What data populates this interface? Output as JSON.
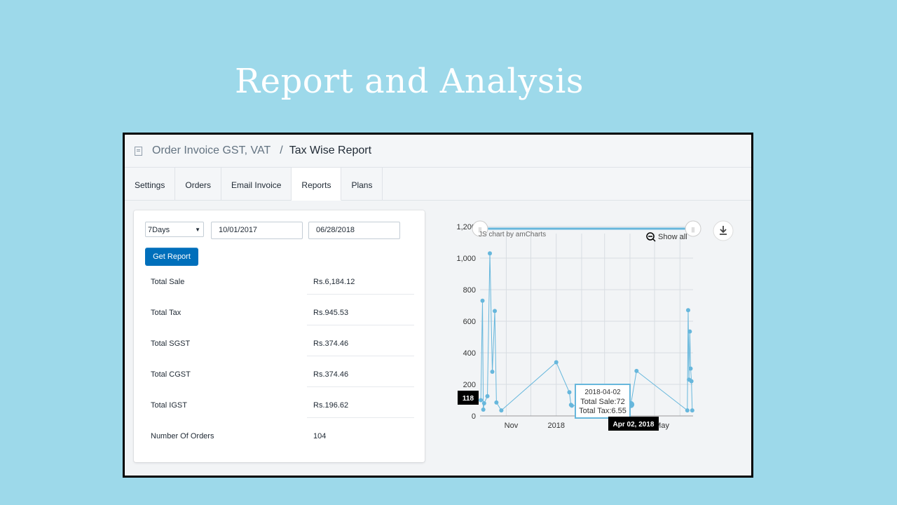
{
  "slide_title": "Report and Analysis",
  "header": {
    "app_name": "Order Invoice GST, VAT",
    "separator": "/",
    "page": "Tax Wise Report"
  },
  "tabs": [
    {
      "label": "Settings"
    },
    {
      "label": "Orders"
    },
    {
      "label": "Email Invoice"
    },
    {
      "label": "Reports",
      "active": true
    },
    {
      "label": "Plans"
    }
  ],
  "filters": {
    "period": "7Days",
    "from_date": "10/01/2017",
    "to_date": "06/28/2018",
    "button": "Get Report"
  },
  "summary": [
    {
      "label": "Total Sale",
      "value": "Rs.6,184.12"
    },
    {
      "label": "Total Tax",
      "value": "Rs.945.53"
    },
    {
      "label": "Total SGST",
      "value": "Rs.374.46"
    },
    {
      "label": "Total CGST",
      "value": "Rs.374.46"
    },
    {
      "label": "Total IGST",
      "value": "Rs.196.62"
    },
    {
      "label": "Number Of Orders",
      "value": "104"
    }
  ],
  "chart": {
    "credit": "JS chart by amCharts",
    "show_all": "Show all",
    "cursor_value": "118",
    "cursor_date": "Apr 02, 2018",
    "tooltip": {
      "date": "2018-04-02",
      "sale": "Total Sale:72",
      "tax": "Total Tax:6.55"
    }
  },
  "chart_data": {
    "type": "line",
    "ylim": [
      0,
      1200
    ],
    "y_ticks": [
      "0",
      "200",
      "400",
      "600",
      "800",
      "1,000",
      "1,200"
    ],
    "x_ticks": [
      "Nov",
      "2018",
      "May"
    ],
    "series": [
      {
        "x": [
          "2017-10-01",
          "2017-10-03",
          "2017-10-04",
          "2017-10-05",
          "2017-10-09",
          "2017-10-12",
          "2017-10-15",
          "2017-10-18",
          "2017-10-20",
          "2017-10-26",
          "2018-01-01",
          "2018-01-17",
          "2018-01-19",
          "2018-01-20",
          "2018-04-01",
          "2018-04-02",
          "2018-04-09",
          "2018-06-10",
          "2018-06-11",
          "2018-06-12",
          "2018-06-13",
          "2018-06-14",
          "2018-06-15",
          "2018-06-16"
        ],
        "y": [
          100,
          730,
          40,
          80,
          125,
          1030,
          280,
          665,
          85,
          35,
          340,
          150,
          70,
          65,
          80,
          72,
          285,
          35,
          670,
          230,
          535,
          300,
          220,
          35
        ]
      }
    ]
  },
  "colors": {
    "line": "#67b7dc",
    "button": "#006fbb",
    "background": "#9dd9ea"
  }
}
